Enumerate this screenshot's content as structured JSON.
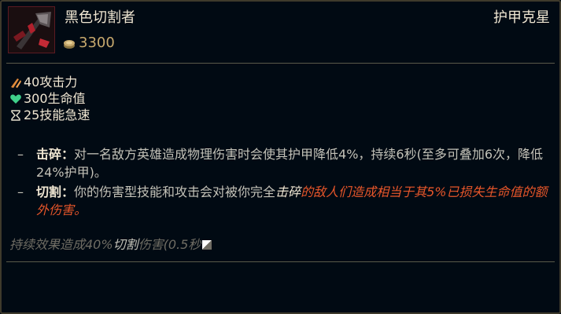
{
  "item": {
    "name": "黑色切割者",
    "cost": "3300",
    "tag": "护甲克星",
    "icon": "black-cleaver-axe-icon"
  },
  "stats": [
    {
      "icon": "attack-damage-icon",
      "label": "40攻击力"
    },
    {
      "icon": "health-heart-icon",
      "label": "300生命值"
    },
    {
      "icon": "ability-haste-hourglass-icon",
      "label": "25技能急速"
    }
  ],
  "passives": [
    {
      "bullet": "–",
      "name": "击碎",
      "colon": "：",
      "text": "对一名敌方英雄造成物理伤害时会使其护甲降低4%，持续6秒(至多可叠加6次，降低24%护甲)。"
    },
    {
      "bullet": "–",
      "name": "切割",
      "colon": "：",
      "text_before": "你的伤害型技能和攻击会对被你完全",
      "keyword": "击碎",
      "highlight": "的敌人们造成相当于其5%已损失生命值的额外伤害。"
    }
  ],
  "flavor": {
    "before": "持续效果造成40%",
    "keyword": "切割",
    "after": "伤害(0.5秒"
  },
  "colors": {
    "background": "#010a13",
    "border": "#3f3a2c",
    "gold": "#c8aa6e",
    "text_main": "#f0e6d2",
    "text_body": "#c4c2b8",
    "highlight_orange": "#e8562a",
    "health_green": "#3fd08a"
  }
}
